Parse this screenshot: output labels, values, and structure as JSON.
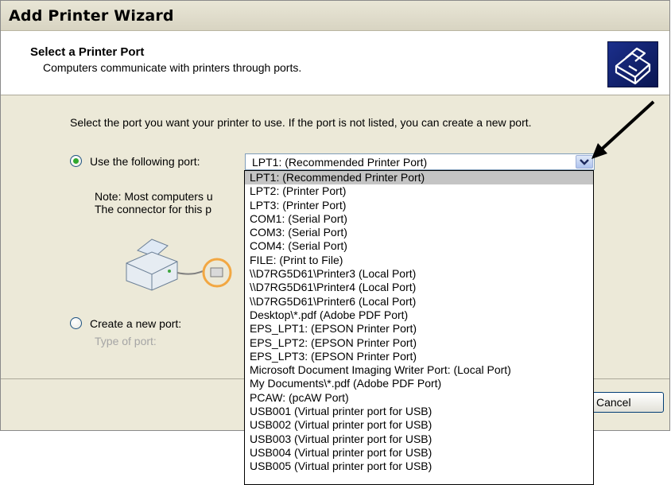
{
  "window": {
    "title": "Add Printer Wizard"
  },
  "header": {
    "title": "Select a Printer Port",
    "subtitle": "Computers communicate with printers through ports."
  },
  "instructions": "Select the port you want your printer to use.  If the port is not listed, you can create a new port.",
  "use_port": {
    "label": "Use the following port:",
    "selected": true,
    "combo_value": "LPT1: (Recommended Printer Port)"
  },
  "note": {
    "line1": "Note: Most computers u",
    "line2": "The connector for this p"
  },
  "create_port": {
    "label": "Create a new port:",
    "selected": false,
    "type_label": "Type of port:"
  },
  "footer": {
    "cancel_label": "Cancel"
  },
  "dropdown": {
    "options": [
      "LPT1: (Recommended Printer Port)",
      "LPT2: (Printer Port)",
      "LPT3: (Printer Port)",
      "COM1: (Serial Port)",
      "COM3: (Serial Port)",
      "COM4: (Serial Port)",
      "FILE: (Print to File)",
      "\\\\D7RG5D61\\Printer3 (Local Port)",
      "\\\\D7RG5D61\\Printer4 (Local Port)",
      "\\\\D7RG5D61\\Printer6 (Local Port)",
      "Desktop\\*.pdf (Adobe PDF Port)",
      "EPS_LPT1: (EPSON Printer Port)",
      "EPS_LPT2: (EPSON Printer Port)",
      "EPS_LPT3: (EPSON Printer Port)",
      "Microsoft Document Imaging Writer Port: (Local Port)",
      "My Documents\\*.pdf (Adobe PDF Port)",
      "PCAW: (pcAW Port)",
      "USB001 (Virtual printer port for USB)",
      "USB002 (Virtual printer port for USB)",
      "USB003 (Virtual printer port for USB)",
      "USB004 (Virtual printer port for USB)",
      "USB005 (Virtual printer port for USB)"
    ],
    "highlighted_index": 0
  },
  "colors": {
    "radio_selected": "#2fa82f",
    "highlight": "#c4c4c4",
    "logo_bg": "#0a1652"
  }
}
